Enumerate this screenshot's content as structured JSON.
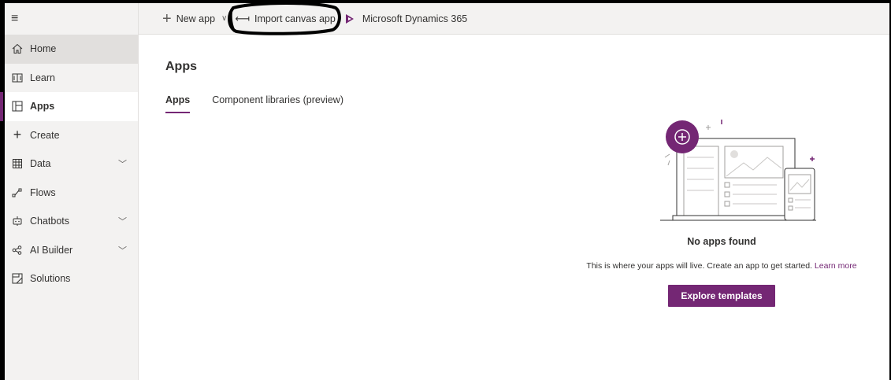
{
  "sidebar": {
    "items": [
      {
        "label": "Home",
        "icon": "home-icon"
      },
      {
        "label": "Learn",
        "icon": "book-icon"
      },
      {
        "label": "Apps",
        "icon": "apps-icon"
      },
      {
        "label": "Create",
        "icon": "plus-icon"
      },
      {
        "label": "Data",
        "icon": "table-icon"
      },
      {
        "label": "Flows",
        "icon": "flow-icon"
      },
      {
        "label": "Chatbots",
        "icon": "bot-icon"
      },
      {
        "label": "AI Builder",
        "icon": "ai-builder-icon"
      },
      {
        "label": "Solutions",
        "icon": "solutions-icon"
      }
    ]
  },
  "toolbar": {
    "new_app": "New app",
    "import_canvas": "Import canvas app",
    "dynamics": "Microsoft Dynamics 365"
  },
  "main": {
    "title": "Apps",
    "tabs": [
      {
        "label": "Apps",
        "selected": true
      },
      {
        "label": "Component libraries (preview)",
        "selected": false
      }
    ],
    "empty_state": {
      "heading": "No apps found",
      "description": "This is where your apps will live. Create an app to get started.",
      "learn_more": "Learn more",
      "button": "Explore templates"
    }
  },
  "colors": {
    "accent": "#742774",
    "sidebar_bg": "#f3f2f1",
    "annotation": "#000000"
  }
}
